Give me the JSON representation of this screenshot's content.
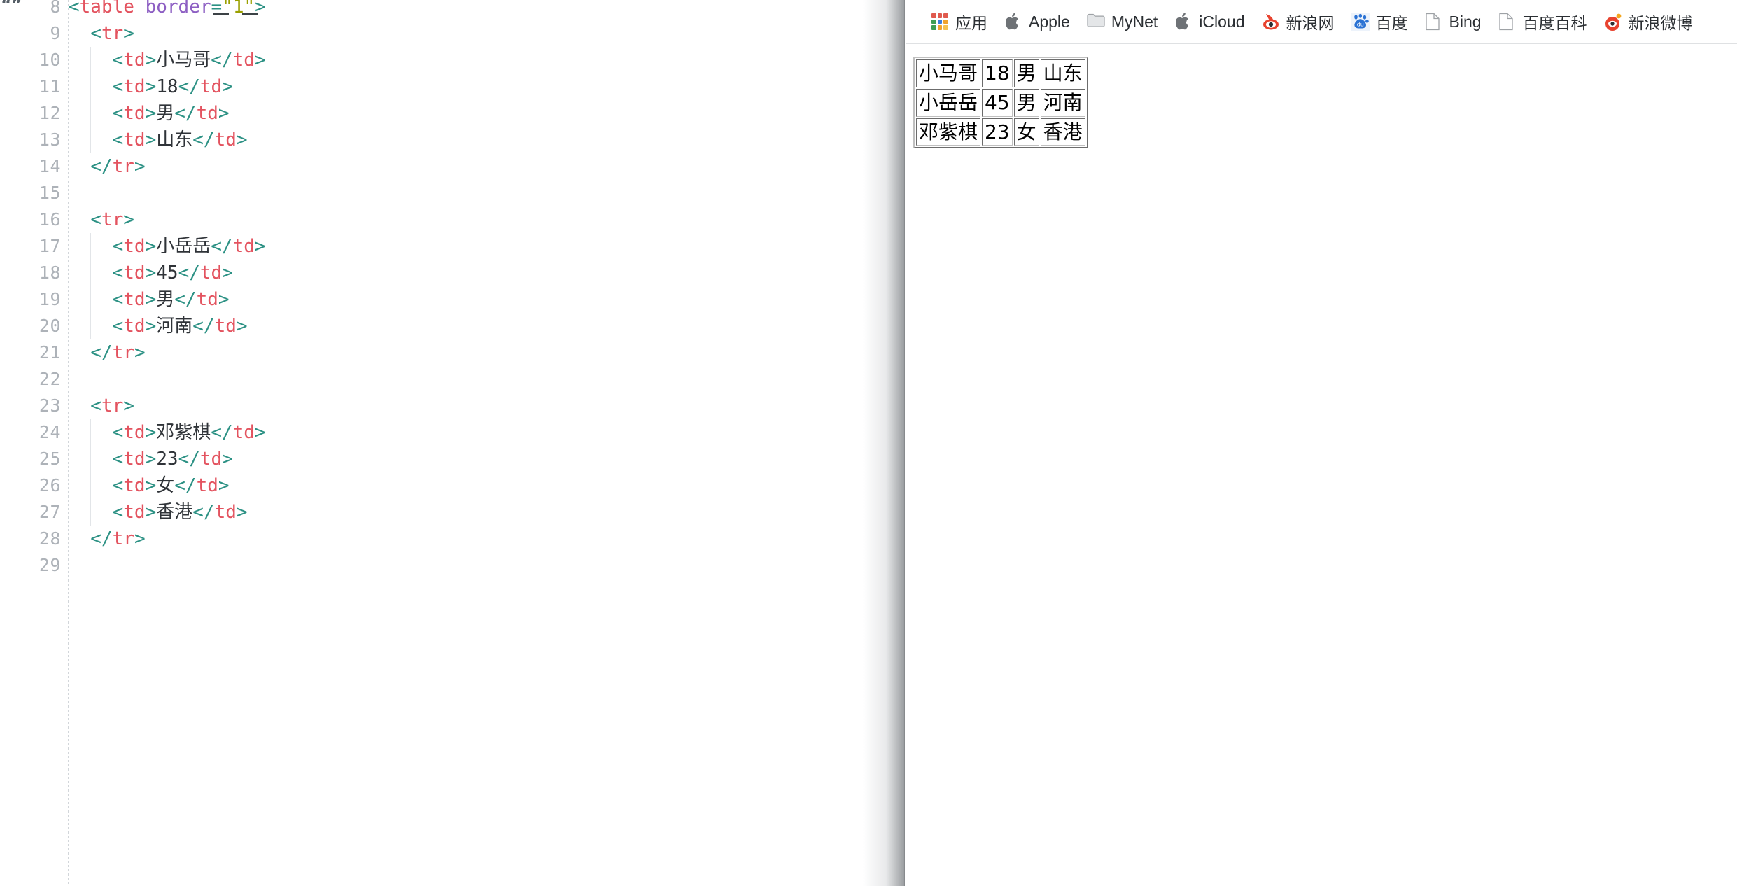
{
  "editor": {
    "fold_marker": "“”",
    "active_line": 8,
    "first_line": 8,
    "lines": [
      {
        "num": "8",
        "indent": 0,
        "tokens": [
          {
            "c": "brk",
            "t": "<"
          },
          {
            "c": "tag",
            "t": "table"
          },
          {
            "c": "txt",
            "t": " "
          },
          {
            "c": "attr",
            "t": "border"
          },
          {
            "c": "eq",
            "t": "="
          },
          {
            "c": "val",
            "t": "\"1\""
          },
          {
            "c": "brk",
            "t": ">"
          }
        ]
      },
      {
        "num": "9",
        "indent": 1,
        "tokens": [
          {
            "c": "brk",
            "t": "  <"
          },
          {
            "c": "tag",
            "t": "tr"
          },
          {
            "c": "brk",
            "t": ">"
          }
        ]
      },
      {
        "num": "10",
        "indent": 2,
        "tokens": [
          {
            "c": "brk",
            "t": "    <"
          },
          {
            "c": "tag",
            "t": "td"
          },
          {
            "c": "brk",
            "t": ">"
          },
          {
            "c": "txt",
            "t": "小马哥"
          },
          {
            "c": "brk",
            "t": "</"
          },
          {
            "c": "tag",
            "t": "td"
          },
          {
            "c": "brk",
            "t": ">"
          }
        ]
      },
      {
        "num": "11",
        "indent": 2,
        "tokens": [
          {
            "c": "brk",
            "t": "    <"
          },
          {
            "c": "tag",
            "t": "td"
          },
          {
            "c": "brk",
            "t": ">"
          },
          {
            "c": "txt",
            "t": "18"
          },
          {
            "c": "brk",
            "t": "</"
          },
          {
            "c": "tag",
            "t": "td"
          },
          {
            "c": "brk",
            "t": ">"
          }
        ]
      },
      {
        "num": "12",
        "indent": 2,
        "tokens": [
          {
            "c": "brk",
            "t": "    <"
          },
          {
            "c": "tag",
            "t": "td"
          },
          {
            "c": "brk",
            "t": ">"
          },
          {
            "c": "txt",
            "t": "男"
          },
          {
            "c": "brk",
            "t": "</"
          },
          {
            "c": "tag",
            "t": "td"
          },
          {
            "c": "brk",
            "t": ">"
          }
        ]
      },
      {
        "num": "13",
        "indent": 2,
        "tokens": [
          {
            "c": "brk",
            "t": "    <"
          },
          {
            "c": "tag",
            "t": "td"
          },
          {
            "c": "brk",
            "t": ">"
          },
          {
            "c": "txt",
            "t": "山东"
          },
          {
            "c": "brk",
            "t": "</"
          },
          {
            "c": "tag",
            "t": "td"
          },
          {
            "c": "brk",
            "t": ">"
          }
        ]
      },
      {
        "num": "14",
        "indent": 1,
        "tokens": [
          {
            "c": "brk",
            "t": "  </"
          },
          {
            "c": "tag",
            "t": "tr"
          },
          {
            "c": "brk",
            "t": ">"
          }
        ]
      },
      {
        "num": "15",
        "indent": 0,
        "tokens": []
      },
      {
        "num": "16",
        "indent": 1,
        "tokens": [
          {
            "c": "brk",
            "t": "  <"
          },
          {
            "c": "tag",
            "t": "tr"
          },
          {
            "c": "brk",
            "t": ">"
          }
        ]
      },
      {
        "num": "17",
        "indent": 2,
        "tokens": [
          {
            "c": "brk",
            "t": "    <"
          },
          {
            "c": "tag",
            "t": "td"
          },
          {
            "c": "brk",
            "t": ">"
          },
          {
            "c": "txt",
            "t": "小岳岳"
          },
          {
            "c": "brk",
            "t": "</"
          },
          {
            "c": "tag",
            "t": "td"
          },
          {
            "c": "brk",
            "t": ">"
          }
        ]
      },
      {
        "num": "18",
        "indent": 2,
        "tokens": [
          {
            "c": "brk",
            "t": "    <"
          },
          {
            "c": "tag",
            "t": "td"
          },
          {
            "c": "brk",
            "t": ">"
          },
          {
            "c": "txt",
            "t": "45"
          },
          {
            "c": "brk",
            "t": "</"
          },
          {
            "c": "tag",
            "t": "td"
          },
          {
            "c": "brk",
            "t": ">"
          }
        ]
      },
      {
        "num": "19",
        "indent": 2,
        "tokens": [
          {
            "c": "brk",
            "t": "    <"
          },
          {
            "c": "tag",
            "t": "td"
          },
          {
            "c": "brk",
            "t": ">"
          },
          {
            "c": "txt",
            "t": "男"
          },
          {
            "c": "brk",
            "t": "</"
          },
          {
            "c": "tag",
            "t": "td"
          },
          {
            "c": "brk",
            "t": ">"
          }
        ]
      },
      {
        "num": "20",
        "indent": 2,
        "tokens": [
          {
            "c": "brk",
            "t": "    <"
          },
          {
            "c": "tag",
            "t": "td"
          },
          {
            "c": "brk",
            "t": ">"
          },
          {
            "c": "txt",
            "t": "河南"
          },
          {
            "c": "brk",
            "t": "</"
          },
          {
            "c": "tag",
            "t": "td"
          },
          {
            "c": "brk",
            "t": ">"
          }
        ]
      },
      {
        "num": "21",
        "indent": 1,
        "tokens": [
          {
            "c": "brk",
            "t": "  </"
          },
          {
            "c": "tag",
            "t": "tr"
          },
          {
            "c": "brk",
            "t": ">"
          }
        ]
      },
      {
        "num": "22",
        "indent": 0,
        "tokens": []
      },
      {
        "num": "23",
        "indent": 1,
        "tokens": [
          {
            "c": "brk",
            "t": "  <"
          },
          {
            "c": "tag",
            "t": "tr"
          },
          {
            "c": "brk",
            "t": ">"
          }
        ]
      },
      {
        "num": "24",
        "indent": 2,
        "tokens": [
          {
            "c": "brk",
            "t": "    <"
          },
          {
            "c": "tag",
            "t": "td"
          },
          {
            "c": "brk",
            "t": ">"
          },
          {
            "c": "txt",
            "t": "邓紫棋"
          },
          {
            "c": "brk",
            "t": "</"
          },
          {
            "c": "tag",
            "t": "td"
          },
          {
            "c": "brk",
            "t": ">"
          }
        ]
      },
      {
        "num": "25",
        "indent": 2,
        "tokens": [
          {
            "c": "brk",
            "t": "    <"
          },
          {
            "c": "tag",
            "t": "td"
          },
          {
            "c": "brk",
            "t": ">"
          },
          {
            "c": "txt",
            "t": "23"
          },
          {
            "c": "brk",
            "t": "</"
          },
          {
            "c": "tag",
            "t": "td"
          },
          {
            "c": "brk",
            "t": ">"
          }
        ]
      },
      {
        "num": "26",
        "indent": 2,
        "tokens": [
          {
            "c": "brk",
            "t": "    <"
          },
          {
            "c": "tag",
            "t": "td"
          },
          {
            "c": "brk",
            "t": ">"
          },
          {
            "c": "txt",
            "t": "女"
          },
          {
            "c": "brk",
            "t": "</"
          },
          {
            "c": "tag",
            "t": "td"
          },
          {
            "c": "brk",
            "t": ">"
          }
        ]
      },
      {
        "num": "27",
        "indent": 2,
        "tokens": [
          {
            "c": "brk",
            "t": "    <"
          },
          {
            "c": "tag",
            "t": "td"
          },
          {
            "c": "brk",
            "t": ">"
          },
          {
            "c": "txt",
            "t": "香港"
          },
          {
            "c": "brk",
            "t": "</"
          },
          {
            "c": "tag",
            "t": "td"
          },
          {
            "c": "brk",
            "t": ">"
          }
        ]
      },
      {
        "num": "28",
        "indent": 1,
        "tokens": [
          {
            "c": "brk",
            "t": "  </"
          },
          {
            "c": "tag",
            "t": "tr"
          },
          {
            "c": "brk",
            "t": ">"
          }
        ]
      },
      {
        "num": "29",
        "indent": 0,
        "tokens": []
      }
    ],
    "colors": {
      "bracket": "#2c9184",
      "tag": "#e3535f",
      "attribute": "#8d5fc3",
      "value": "#9aa000",
      "text": "#2f3338",
      "line_number": "#adb2b8",
      "active_line_bg": "#eef0f2",
      "background": "#ffffff"
    }
  },
  "browser": {
    "bookmarks": [
      {
        "label": "应用",
        "icon": "apps-grid-icon"
      },
      {
        "label": "Apple",
        "icon": "apple-icon"
      },
      {
        "label": "MyNet",
        "icon": "folder-icon"
      },
      {
        "label": "iCloud",
        "icon": "apple-icon"
      },
      {
        "label": "新浪网",
        "icon": "sina-icon"
      },
      {
        "label": "百度",
        "icon": "baidu-icon"
      },
      {
        "label": "Bing",
        "icon": "page-icon"
      },
      {
        "label": "百度百科",
        "icon": "page-icon"
      },
      {
        "label": "新浪微博",
        "icon": "weibo-icon"
      }
    ],
    "apps_icon_colors": [
      "#e05a4e",
      "#e05a4e",
      "#e05a4e",
      "#3f9e55",
      "#3b7ddd",
      "#f0a22e",
      "#3f9e55",
      "#f0a22e",
      "#f5c252"
    ]
  },
  "rendered_table": {
    "border": "1",
    "rows": [
      [
        "小马哥",
        "18",
        "男",
        "山东"
      ],
      [
        "小岳岳",
        "45",
        "男",
        "河南"
      ],
      [
        "邓紫棋",
        "23",
        "女",
        "香港"
      ]
    ]
  }
}
